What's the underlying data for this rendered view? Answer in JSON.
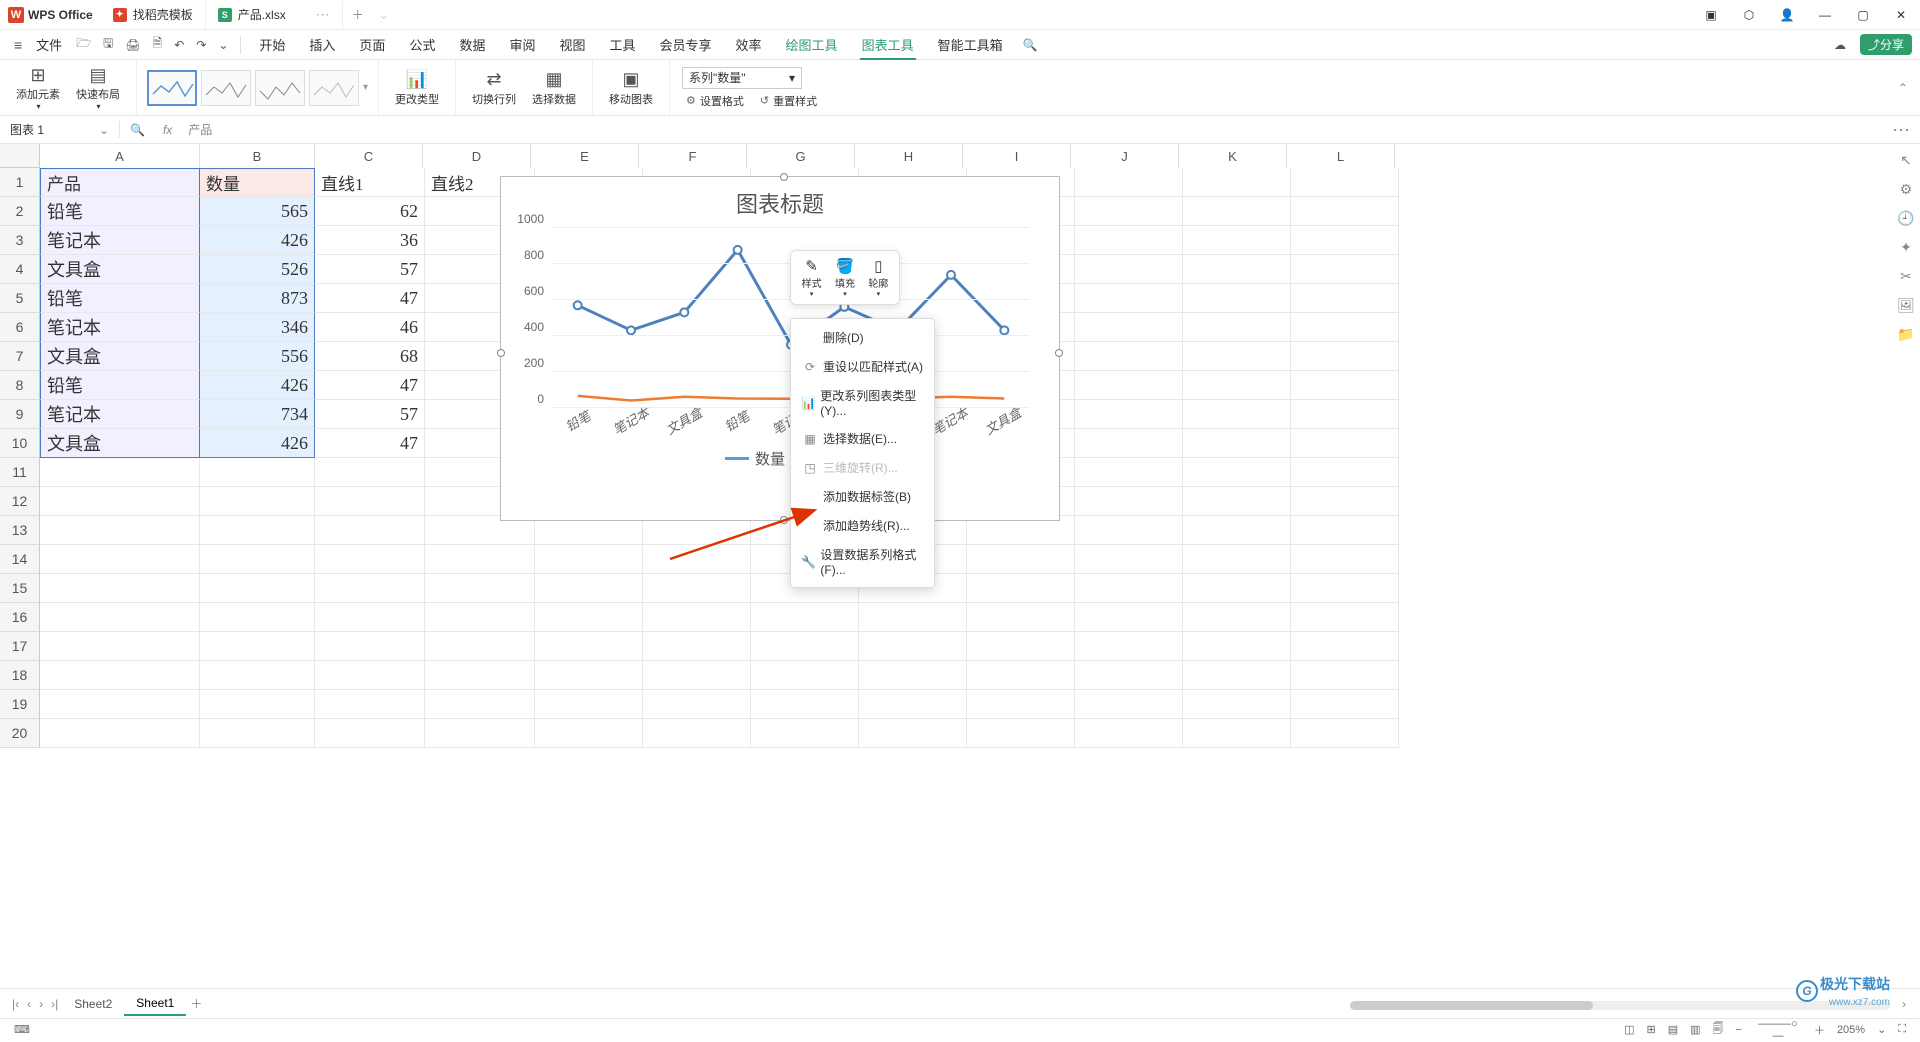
{
  "app": {
    "name": "WPS Office"
  },
  "tabs": [
    {
      "label": "找稻壳模板",
      "icon": "red"
    },
    {
      "label": "产品.xlsx",
      "icon": "green",
      "active": true
    }
  ],
  "menubar": {
    "file": "文件",
    "items": [
      "开始",
      "插入",
      "页面",
      "公式",
      "数据",
      "审阅",
      "视图",
      "工具",
      "会员专享",
      "效率",
      "绘图工具",
      "图表工具",
      "智能工具箱"
    ],
    "active_index": 11,
    "share": "分享"
  },
  "ribbon": {
    "add_element": "添加元素",
    "quick_layout": "快速布局",
    "change_type": "更改类型",
    "switch_rowcol": "切换行列",
    "select_data": "选择数据",
    "move_chart": "移动图表",
    "series_selector": "系列\"数量\"",
    "set_format": "设置格式",
    "reset_style": "重置样式"
  },
  "namebox": "图表 1",
  "formula_text": "产品",
  "columns": [
    "A",
    "B",
    "C",
    "D",
    "E",
    "F",
    "G",
    "H",
    "I",
    "J",
    "K",
    "L"
  ],
  "rows": [
    {
      "n": 1,
      "A": "产品",
      "B": "数量",
      "C": "直线1",
      "D": "直线2"
    },
    {
      "n": 2,
      "A": "铅笔",
      "B": "565",
      "C": "62",
      "D": ""
    },
    {
      "n": 3,
      "A": "笔记本",
      "B": "426",
      "C": "36",
      "D": ""
    },
    {
      "n": 4,
      "A": "文具盒",
      "B": "526",
      "C": "57",
      "D": ""
    },
    {
      "n": 5,
      "A": "铅笔",
      "B": "873",
      "C": "47",
      "D": ""
    },
    {
      "n": 6,
      "A": "笔记本",
      "B": "346",
      "C": "46",
      "D": ""
    },
    {
      "n": 7,
      "A": "文具盒",
      "B": "556",
      "C": "68",
      "D": ""
    },
    {
      "n": 8,
      "A": "铅笔",
      "B": "426",
      "C": "47",
      "D": ""
    },
    {
      "n": 9,
      "A": "笔记本",
      "B": "734",
      "C": "57",
      "D": ""
    },
    {
      "n": 10,
      "A": "文具盒",
      "B": "426",
      "C": "47",
      "D": ""
    }
  ],
  "blank_rows": [
    11,
    12,
    13,
    14,
    15,
    16,
    17,
    18,
    19,
    20
  ],
  "chart_data": {
    "type": "line",
    "title": "图表标题",
    "categories": [
      "铅笔",
      "笔记本",
      "文具盒",
      "铅笔",
      "笔记本",
      "文具盒",
      "铅笔",
      "笔记本",
      "文具盒"
    ],
    "series": [
      {
        "name": "数量",
        "color": "#4f81bd",
        "values": [
          565,
          426,
          526,
          873,
          346,
          556,
          426,
          734,
          426
        ]
      },
      {
        "name": "直线1",
        "color": "#ed7d31",
        "values": [
          62,
          36,
          57,
          47,
          46,
          68,
          47,
          57,
          47
        ]
      },
      {
        "name": "直线2",
        "color": "#a5a5a5",
        "values": [
          null,
          null,
          null,
          null,
          null,
          null,
          null,
          null,
          null
        ]
      }
    ],
    "ylim": [
      0,
      1000
    ],
    "yticks": [
      0,
      200,
      400,
      600,
      800,
      1000
    ]
  },
  "mini_toolbar": {
    "style": "样式",
    "fill": "填充",
    "outline": "轮廓"
  },
  "context_menu": {
    "delete": "删除(D)",
    "reset_match": "重设以匹配样式(A)",
    "change_series_type": "更改系列图表类型(Y)...",
    "select_data": "选择数据(E)...",
    "rotate_3d": "三维旋转(R)...",
    "add_data_labels": "添加数据标签(B)",
    "add_trendline": "添加趋势线(R)...",
    "format_series": "设置数据系列格式(F)..."
  },
  "sheet_tabs": {
    "sheet2": "Sheet2",
    "sheet1": "Sheet1"
  },
  "statusbar": {
    "zoom": "205%"
  },
  "watermark": {
    "title": "极光下载站",
    "url": "www.xz7.com"
  }
}
